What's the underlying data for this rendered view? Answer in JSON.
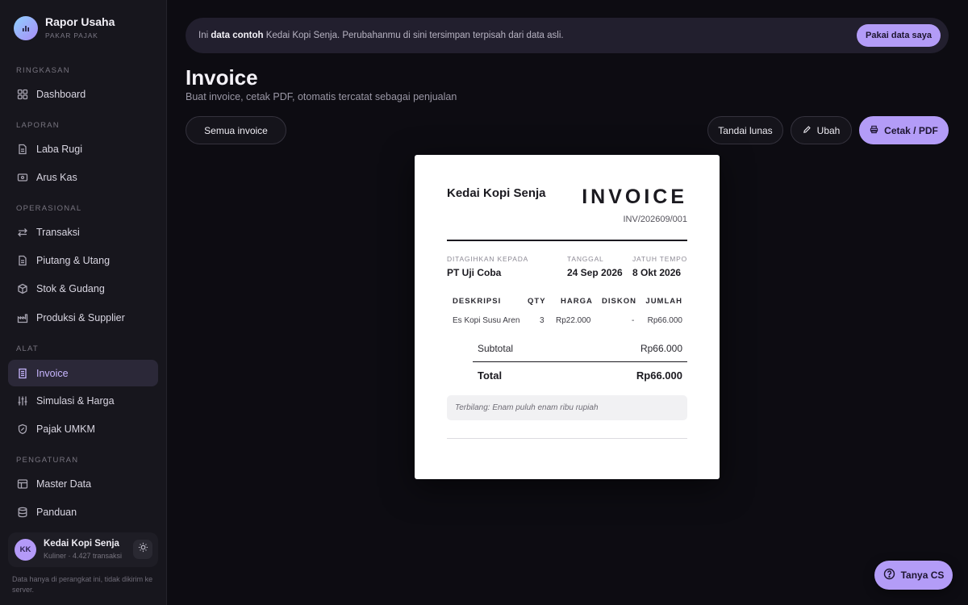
{
  "brand": {
    "title": "Rapor Usaha",
    "subtitle": "PAKAR PAJAK"
  },
  "sidebar": {
    "sections": {
      "ringkasan": "RINGKASAN",
      "laporan": "LAPORAN",
      "operasional": "OPERASIONAL",
      "alat": "ALAT",
      "pengaturan": "PENGATURAN"
    },
    "items": {
      "dashboard": "Dashboard",
      "laba_rugi": "Laba Rugi",
      "arus_kas": "Arus Kas",
      "transaksi": "Transaksi",
      "piutang": "Piutang & Utang",
      "stok": "Stok & Gudang",
      "produksi": "Produksi & Supplier",
      "invoice": "Invoice",
      "simulasi": "Simulasi & Harga",
      "pajak": "Pajak UMKM",
      "master": "Master Data",
      "panduan": "Panduan"
    },
    "active": "Invoice"
  },
  "profile": {
    "initials": "KK",
    "name": "Kedai Kopi Senja",
    "meta": "Kuliner · 4.427 transaksi"
  },
  "footnote": "Data hanya di perangkat ini, tidak dikirim ke server.",
  "banner": {
    "prefix": "Ini",
    "bold": "data contoh",
    "rest": "Kedai Kopi Senja. Perubahanmu di sini tersimpan terpisah dari data asli.",
    "button": "Pakai data saya"
  },
  "page": {
    "title": "Invoice",
    "subtitle": "Buat invoice, cetak PDF, otomatis tercatat sebagai penjualan"
  },
  "toolbar": {
    "all_invoices": "Semua invoice",
    "mark_paid": "Tandai lunas",
    "edit": "Ubah",
    "print": "Cetak / PDF"
  },
  "invoice": {
    "company": "Kedai Kopi Senja",
    "heading": "INVOICE",
    "number": "INV/202609/001",
    "billed_label": "DITAGIHKAN KEPADA",
    "billed_to": "PT Uji Coba",
    "date_label": "TANGGAL",
    "date": "24 Sep 2026",
    "due_label": "JATUH TEMPO",
    "due": "8 Okt 2026",
    "columns": {
      "desc": "DESKRIPSI",
      "qty": "QTY",
      "price": "HARGA",
      "disc": "DISKON",
      "amount": "JUMLAH"
    },
    "rows": [
      {
        "desc": "Es Kopi Susu Aren",
        "qty": "3",
        "price": "Rp22.000",
        "disc": "-",
        "amount": "Rp66.000"
      }
    ],
    "subtotal_label": "Subtotal",
    "subtotal": "Rp66.000",
    "total_label": "Total",
    "total": "Rp66.000",
    "in_words": "Terbilang: Enam puluh enam ribu rupiah"
  },
  "help_button": "Tanya CS",
  "colors": {
    "accent": "#b39cf7",
    "background": "#0d0c12",
    "sidebar": "#17161d"
  }
}
